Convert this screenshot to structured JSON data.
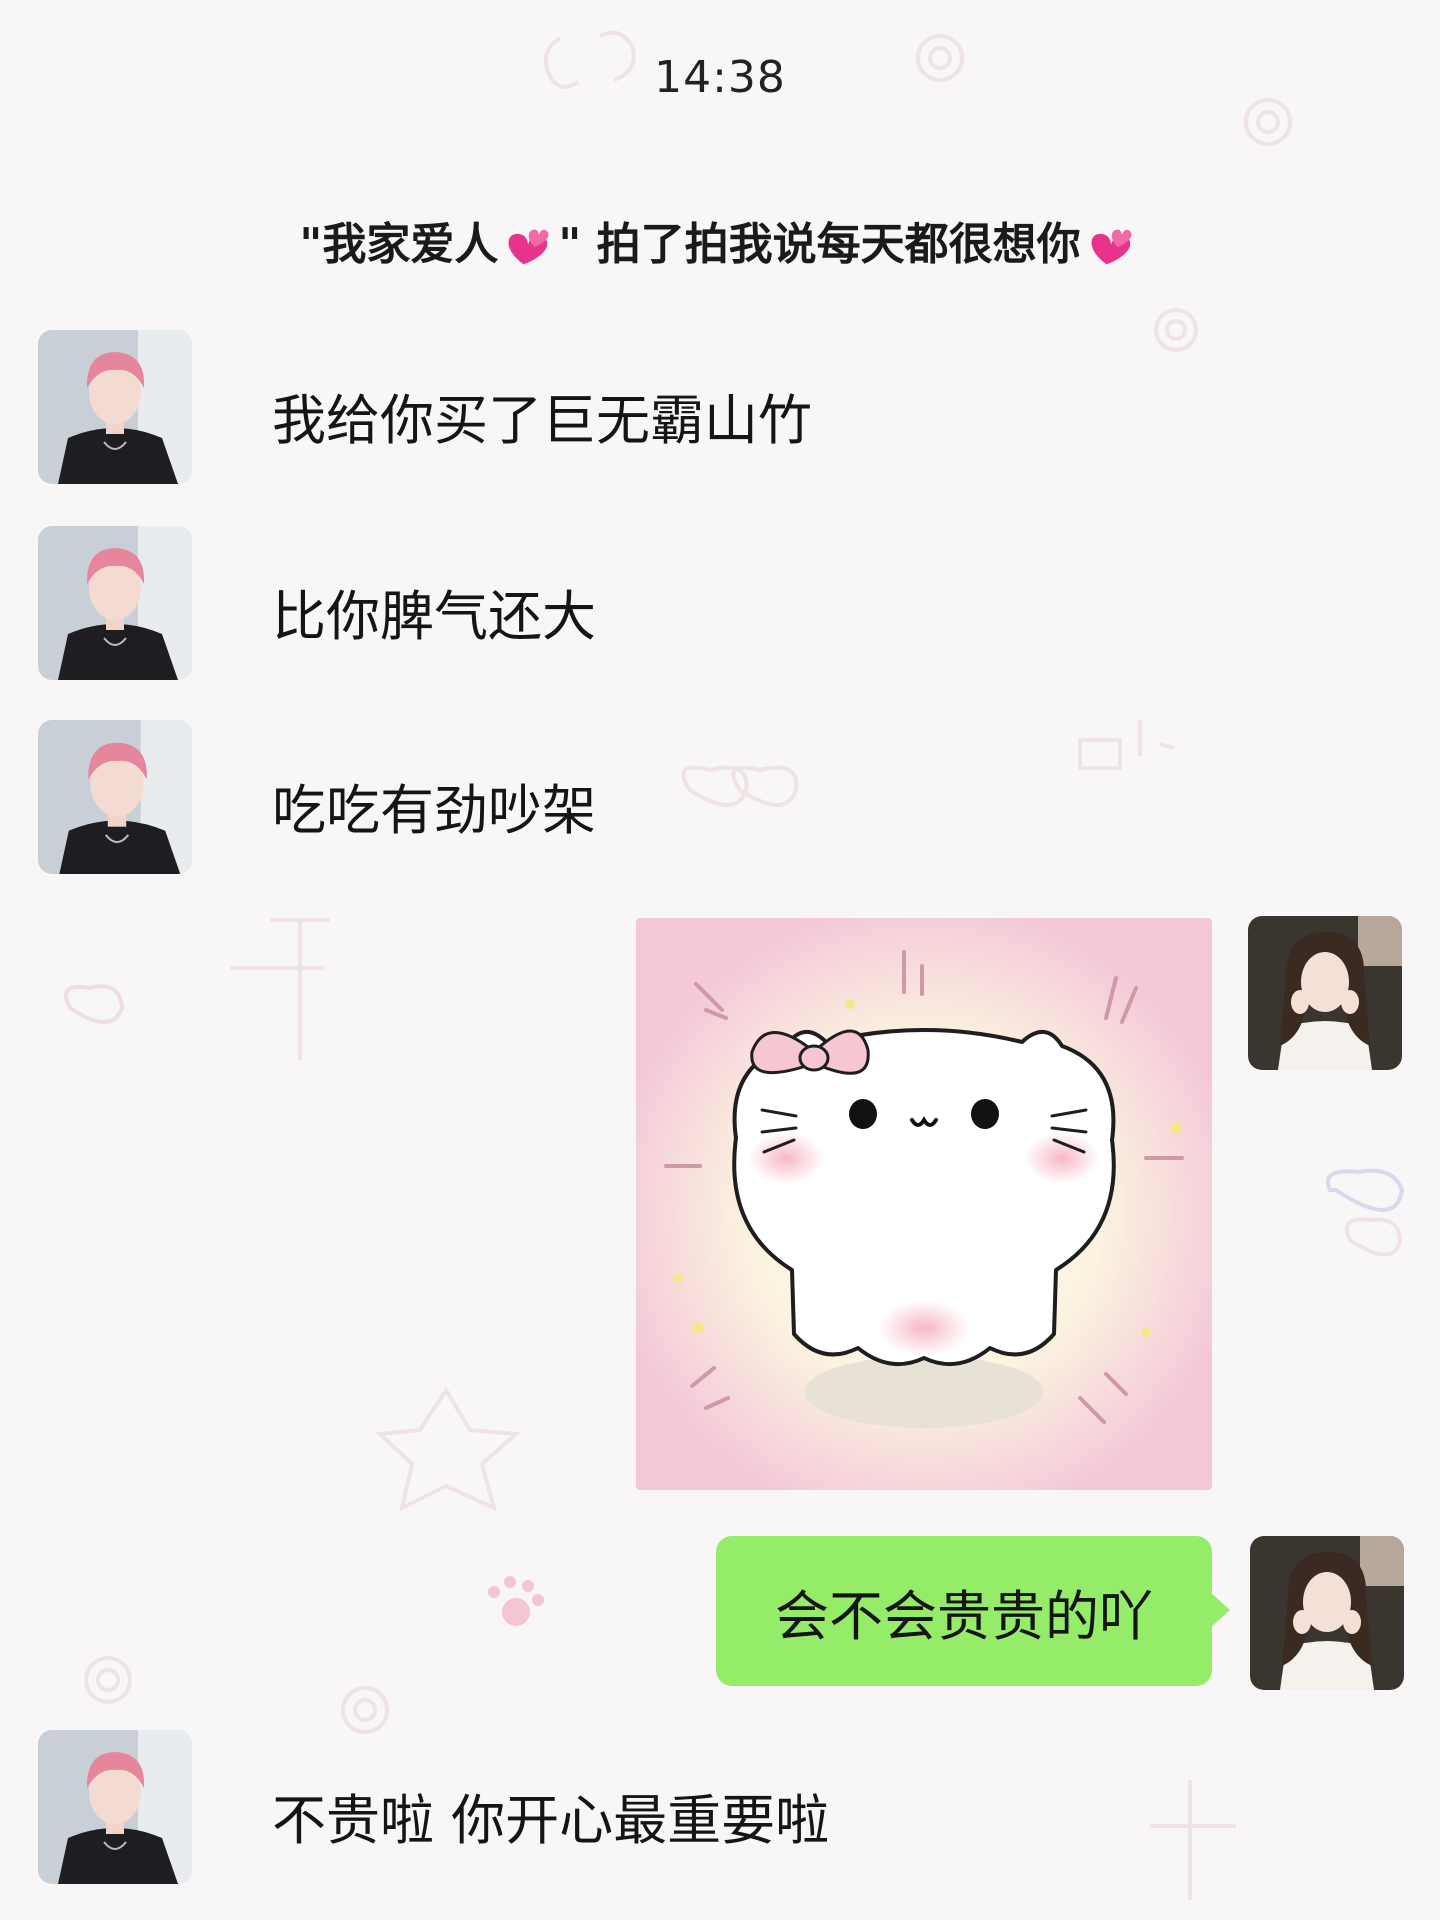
{
  "status": {
    "time": "14:38"
  },
  "system_notice": {
    "part1": "\"我家爱人",
    "part2": "\" 拍了拍我说每天都很想你",
    "emoji": "pink-hearts"
  },
  "messages": [
    {
      "side": "left",
      "avatar": "boy-avatar",
      "text": "我给你买了巨无霸山竹"
    },
    {
      "side": "left",
      "avatar": "boy-avatar",
      "text": "比你脾气还大"
    },
    {
      "side": "left",
      "avatar": "boy-avatar",
      "text": "吃吃有劲吵架"
    },
    {
      "side": "right",
      "avatar": "girl-avatar",
      "type": "sticker",
      "sticker": "white-cat-with-pink-bow"
    },
    {
      "side": "right",
      "avatar": "girl-avatar",
      "text": "会不会贵贵的吖"
    },
    {
      "side": "left",
      "avatar": "boy-avatar",
      "text": "不贵啦 你开心最重要啦"
    }
  ],
  "colors": {
    "background": "#f8f6f6",
    "sent_bubble": "#95ec69",
    "sticker_bg": "#f6d3df",
    "heart": "#e8338c"
  }
}
